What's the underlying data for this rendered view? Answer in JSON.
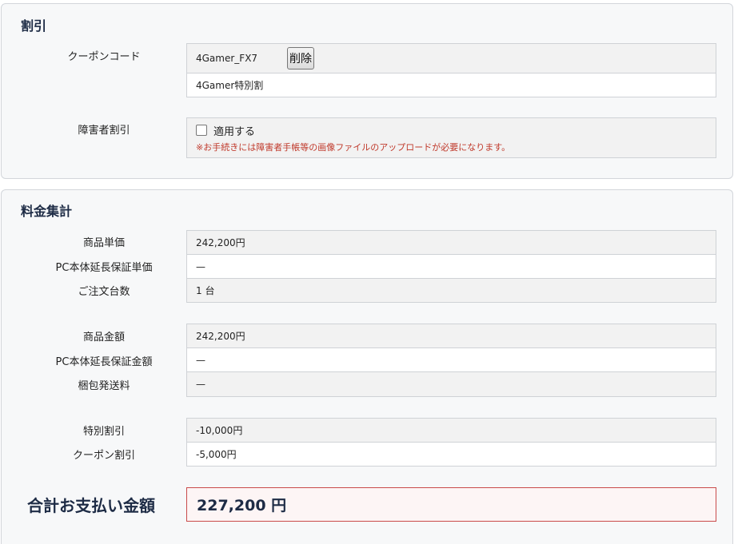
{
  "discount": {
    "title": "割引",
    "coupon_label": "クーポンコード",
    "coupon_code": "4Gamer_FX7",
    "delete_button": "削除",
    "coupon_name": "4Gamer特別割",
    "disability_label": "障害者割引",
    "apply_label": "適用する",
    "note": "※お手続きには障害者手帳等の画像ファイルのアップロードが必要になります。"
  },
  "summary": {
    "title": "料金集計",
    "rows_group1": [
      {
        "label": "商品単価",
        "value": "242,200円"
      },
      {
        "label": "PC本体延長保証単価",
        "value": "—"
      },
      {
        "label": "ご注文台数",
        "value": "1 台"
      }
    ],
    "rows_group2": [
      {
        "label": "商品金額",
        "value": "242,200円"
      },
      {
        "label": "PC本体延長保証金額",
        "value": "—"
      },
      {
        "label": "梱包発送料",
        "value": "—"
      }
    ],
    "rows_group3": [
      {
        "label": "特別割引",
        "value": "-10,000円"
      },
      {
        "label": "クーポン割引",
        "value": "-5,000円"
      }
    ],
    "total_label": "合計お支払い金額",
    "total_value": "227,200 円"
  },
  "colors": {
    "title": "#1d2b45",
    "note": "#c0392b",
    "total_border": "#c94b4b"
  }
}
